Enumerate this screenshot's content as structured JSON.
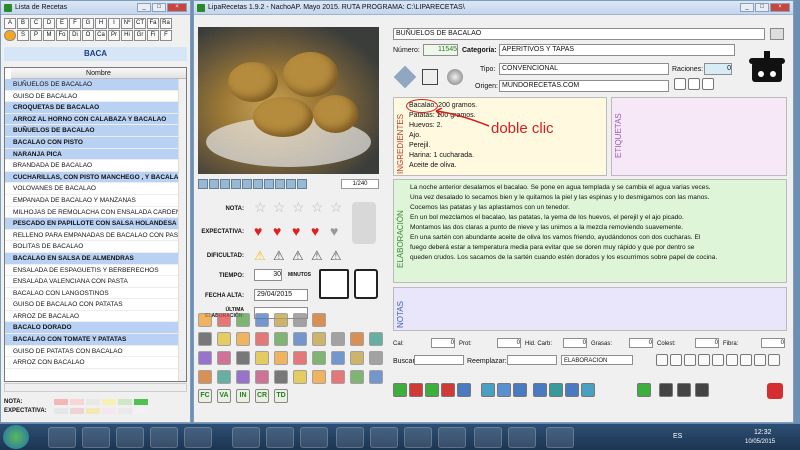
{
  "left": {
    "title": "Lista de Recetas",
    "letters": [
      "A",
      "B",
      "C",
      "D",
      "E",
      "F",
      "G",
      "H",
      "I",
      "Nº",
      "CT",
      "Fa",
      "Ra",
      "",
      "S",
      "P",
      "M",
      "Fo",
      "Di",
      "O",
      "Ca",
      "Pr",
      "Hi",
      "Gr",
      "Fi",
      "F"
    ],
    "category": "BACA",
    "column": "Nombre",
    "rows": [
      {
        "t": "BUÑUELOS DE BACALAO",
        "b": false,
        "hl": true
      },
      {
        "t": "GUISO DE BACALAO",
        "b": false,
        "hl": false
      },
      {
        "t": "CROQUETAS DE BACALAO",
        "b": true,
        "hl": true
      },
      {
        "t": "ARROZ AL HORNO CON CALABAZA Y BACALAO",
        "b": true,
        "hl": true
      },
      {
        "t": "BUÑUELOS DE BACALAO",
        "b": true,
        "hl": true
      },
      {
        "t": "BACALAO CON PISTO",
        "b": true,
        "hl": true
      },
      {
        "t": "NARANJA PICA",
        "b": true,
        "hl": true
      },
      {
        "t": "BRANDADA DE BACALAO",
        "b": false,
        "hl": false
      },
      {
        "t": "CUCHARILLAS, CON PISTO MANCHEGO , Y BACALAO",
        "b": true,
        "hl": true
      },
      {
        "t": "VOLOVANES DE BACALAO",
        "b": false,
        "hl": false
      },
      {
        "t": "EMPANADA DE BACALAO Y MANZANAS",
        "b": false,
        "hl": false
      },
      {
        "t": "MILHOJAS DE REMOLACHA CON ENSALADA CARDENAL",
        "b": false,
        "hl": false
      },
      {
        "t": "PESCADO EN PAPILLOTE CON SALSA HOLANDESA",
        "b": true,
        "hl": true
      },
      {
        "t": "RELLENO PARA EMPANADAS DE BACALAO CON PASAS",
        "b": false,
        "hl": false
      },
      {
        "t": "BOLITAS DE BACALAO",
        "b": false,
        "hl": false
      },
      {
        "t": "BACALAO EN SALSA DE ALMENDRAS",
        "b": true,
        "hl": true
      },
      {
        "t": "ENSALADA DE ESPAGUETIS Y BERBERECHOS",
        "b": false,
        "hl": false
      },
      {
        "t": "ENSALADA VALENCIANA CON PASTA",
        "b": false,
        "hl": false
      },
      {
        "t": "BACALAO CON LANGOSTINOS",
        "b": false,
        "hl": false
      },
      {
        "t": "GUISO DE BACALAO CON PATATAS",
        "b": false,
        "hl": false
      },
      {
        "t": "ARROZ DE BACALAO",
        "b": false,
        "hl": false
      },
      {
        "t": "BACALO DORADO",
        "b": true,
        "hl": true
      },
      {
        "t": "BACALAO CON TOMATE Y PATATAS",
        "b": true,
        "hl": true
      },
      {
        "t": "GUISO DE PATATAS CON BACALAO",
        "b": false,
        "hl": false
      },
      {
        "t": "ARROZ CON BACALAO",
        "b": false,
        "hl": false
      }
    ],
    "nota_label": "NOTA:",
    "expectativa_label": "EXPECTATIVA:"
  },
  "main": {
    "title": "LipaRecetas 1.9.2 - NachoAP. Mayo 2015. RUTA PROGRAMA: C:\\LIPARECETAS\\",
    "recipe_name": "BUÑUELOS DE BACALAO",
    "numero_label": "Número:",
    "numero": "11545",
    "categoria_label": "Categoría:",
    "categoria": "APERITIVOS Y TAPAS",
    "tipo_label": "Tipo:",
    "tipo": "CONVENCIONAL",
    "raciones_label": "Raciones:",
    "raciones": "0",
    "origen_label": "Origen:",
    "origen": "MUNDORECETAS.COM",
    "counter": "1/240",
    "nota_label": "NOTA:",
    "expectativa_label": "EXPECTATIVA:",
    "dificultad_label": "DIFICULTAD:",
    "tiempo_label": "TIEMPO:",
    "tiempo": "30",
    "minutos_label": "MINUTOS",
    "fecha_label": "FECHA ALTA:",
    "fecha": "29/04/2015",
    "ultima_label": "ÚLTIMA ELABORACIÓN:",
    "ingredientes_label": "INGREDIENTES",
    "etiquetas_label": "ETIQUETAS",
    "elaboracion_label": "ELABORACIÓN",
    "notas_label": "NOTAS",
    "ingredients": [
      "Bacalao: 200 gramos.",
      "Patatas: 100 gramos.",
      "Huevos: 2.",
      "Ajo.",
      "Perejil.",
      "Harina: 1 cucharada.",
      "Aceite de oliva."
    ],
    "annotation": "doble clic",
    "elaboracion_lines": [
      "La noche anterior desalamos el bacalao. Se pone en agua templada y se cambia el agua varias veces.",
      "Una vez desalado lo secamos bien y le quitamos la piel y las espinas y lo desmigamos con las manos.",
      "Cocemos las patatas y las aplastamos con un tenedor.",
      "En un bol mezclamos el bacalao, las patatas, la yema de los huevos, el perejil y el ajo picado.",
      "Montamos las dos claras a punto de nieve y las unimos a la mezcla removiendo suavemente.",
      "En una sartén con abundante aceite de oliva los vamos friendo, ayudándonos con dos cucharas. El",
      "fuego deberá estar a temperatura media para evitar que se doren muy rápido y que por dentro se",
      "queden crudos. Los sacamos de la sartén cuando estén dorados y los escurrimos sobre papel de cocina."
    ],
    "nutri": [
      {
        "l": "Cal:",
        "v": "0"
      },
      {
        "l": "Prot:",
        "v": "0"
      },
      {
        "l": "Hid. Carb:",
        "v": "0"
      },
      {
        "l": "Grasas:",
        "v": "0"
      },
      {
        "l": "Colest:",
        "v": "0"
      },
      {
        "l": "Fibra:",
        "v": "0"
      }
    ],
    "buscar_label": "Buscar:",
    "reemplazar_label": "Reemplazar:",
    "field_select": "ELABORACION",
    "left_icon_row": [
      "FC",
      "VA",
      "IN",
      "CR",
      "TD"
    ]
  },
  "taskbar": {
    "lang": "ES",
    "time": "12:32",
    "date": "10/05/2015"
  }
}
